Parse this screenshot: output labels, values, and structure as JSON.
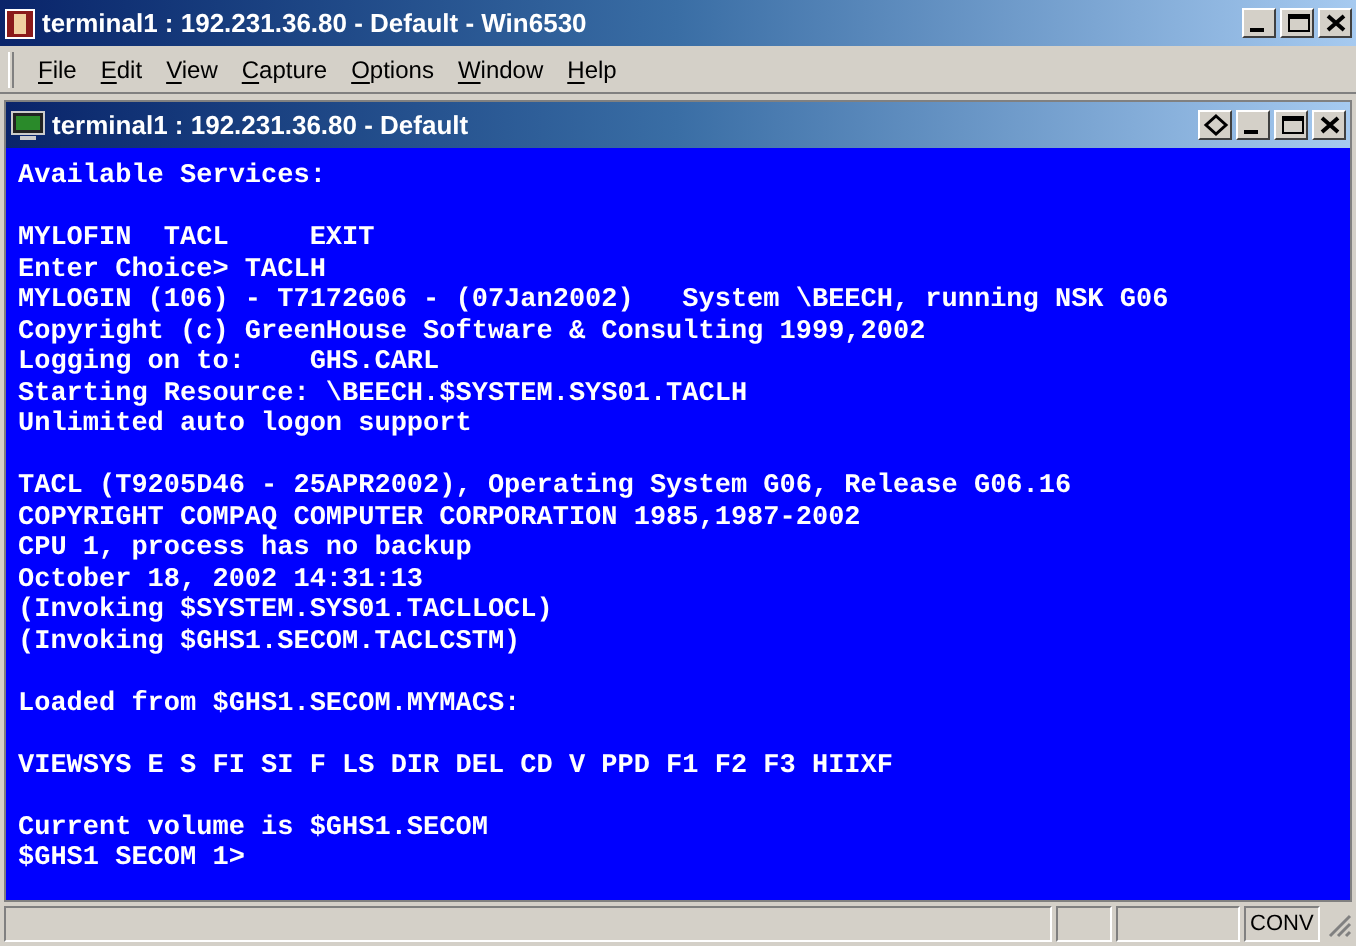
{
  "window": {
    "title": "terminal1 : 192.231.36.80 - Default - Win6530"
  },
  "menu": [
    "File",
    "Edit",
    "View",
    "Capture",
    "Options",
    "Window",
    "Help"
  ],
  "child_window": {
    "title": "terminal1 : 192.231.36.80 - Default"
  },
  "terminal": {
    "blocks": [
      [
        "Available Services:"
      ],
      [
        "MYLOFIN  TACL     EXIT",
        "Enter Choice> TACLH",
        "MYLOGIN (106) - T7172G06 - (07Jan2002)   System \\BEECH, running NSK G06",
        "Copyright (c) GreenHouse Software & Consulting 1999,2002",
        "Logging on to:    GHS.CARL",
        "Starting Resource: \\BEECH.$SYSTEM.SYS01.TACLH",
        "Unlimited auto logon support"
      ],
      [
        "TACL (T9205D46 - 25APR2002), Operating System G06, Release G06.16",
        "COPYRIGHT COMPAQ COMPUTER CORPORATION 1985,1987-2002",
        "CPU 1, process has no backup",
        "October 18, 2002 14:31:13",
        "(Invoking $SYSTEM.SYS01.TACLLOCL)",
        "(Invoking $GHS1.SECOM.TACLCSTM)"
      ],
      [
        "Loaded from $GHS1.SECOM.MYMACS:"
      ],
      [
        "VIEWSYS E S FI SI F LS DIR DEL CD V PPD F1 F2 F3 HIIXF"
      ],
      [
        "Current volume is $GHS1.SECOM",
        "$GHS1 SECOM 1>"
      ]
    ]
  },
  "status_bar": {
    "mode": "CONV"
  }
}
